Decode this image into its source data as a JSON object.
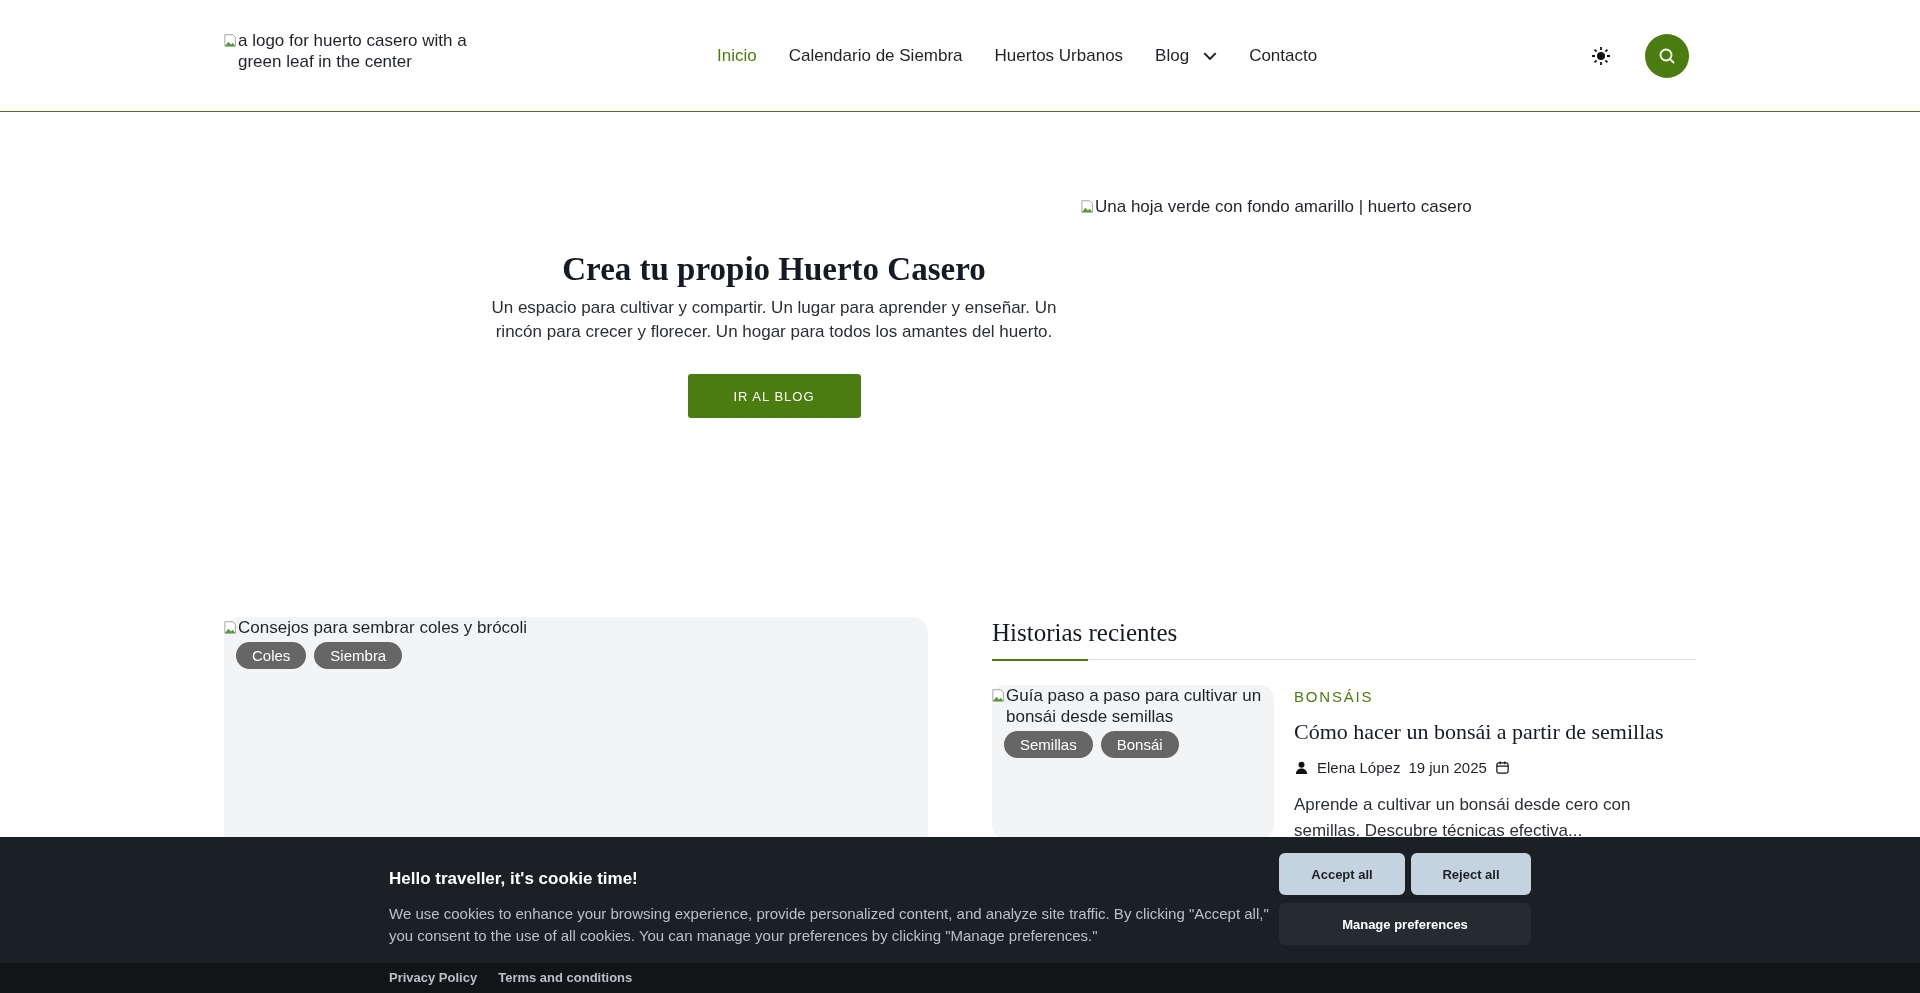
{
  "header": {
    "logo_alt": "a logo for huerto casero with a green leaf in the center",
    "nav": [
      {
        "label": "Inicio",
        "selected": true,
        "kind": "link"
      },
      {
        "label": "Calendario de Siembra",
        "selected": false,
        "kind": "link"
      },
      {
        "label": "Huertos Urbanos",
        "selected": false,
        "kind": "link"
      },
      {
        "label": "Blog",
        "selected": false,
        "kind": "dropdown"
      },
      {
        "label": "Contacto",
        "selected": false,
        "kind": "link"
      }
    ]
  },
  "hero": {
    "title": "Crea tu propio Huerto Casero",
    "text": "Un espacio para cultivar y compartir. Un lugar para aprender y enseñar. Un rincón para crecer y florecer. Un hogar para todos los amantes del huerto.",
    "button": "IR AL BLOG",
    "image_alt": "Una hoja verde con fondo amarillo | huerto casero"
  },
  "featured": {
    "image_alt": "Consejos para sembrar coles y brócoli",
    "tags": [
      "Coles",
      "Siembra"
    ]
  },
  "recent": {
    "heading": "Historias recientes",
    "posts": [
      {
        "image_alt": "Guía paso a paso para cultivar un bonsái desde semillas",
        "tags": [
          "Semillas",
          "Bonsái"
        ],
        "category": "BONSÁIS",
        "title": "Cómo hacer un bonsái a partir de semillas",
        "author": "Elena López",
        "date": "19 jun 2025",
        "excerpt": "Aprende a cultivar un bonsái desde cero con semillas. Descubre técnicas efectiva..."
      }
    ]
  },
  "cookie": {
    "title": "Hello traveller, it's cookie time!",
    "text": "We use cookies to enhance your browsing experience, provide personalized content, and analyze site traffic. By clicking \"Accept all,\" you consent to the use of all cookies. You can manage your preferences by clicking \"Manage preferences.\"",
    "buttons": [
      {
        "label": "Accept all",
        "kind": "primary"
      },
      {
        "label": "Reject all",
        "kind": "primary"
      },
      {
        "label": "Manage preferences",
        "kind": "secondary"
      }
    ],
    "links": [
      "Privacy Policy",
      "Terms and conditions"
    ]
  }
}
